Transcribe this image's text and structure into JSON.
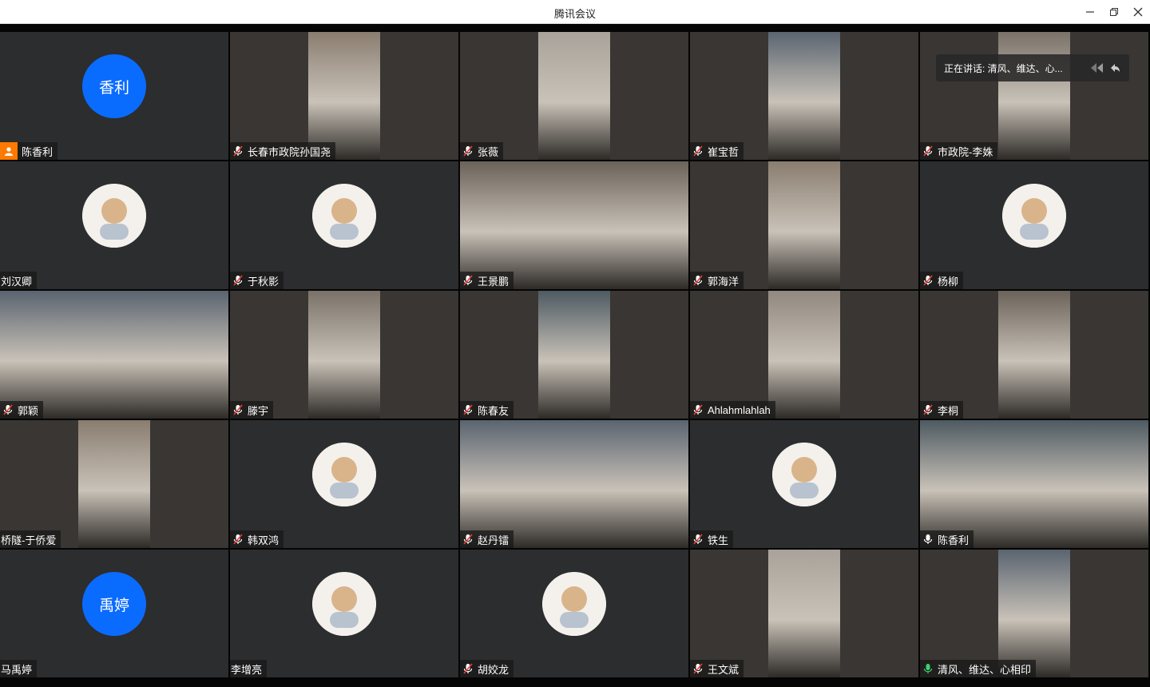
{
  "window": {
    "title": "腾讯会议"
  },
  "speaking_banner": {
    "text": "正在讲话: 清风、维达、心..."
  },
  "participants": [
    {
      "name": "陈香利",
      "kind": "text",
      "avatar_text": "香利",
      "mic": "host"
    },
    {
      "name": "长春市政院孙国尧",
      "kind": "video",
      "mic": "muted"
    },
    {
      "name": "张薇",
      "kind": "video",
      "mic": "muted"
    },
    {
      "name": "崔宝哲",
      "kind": "video",
      "mic": "muted"
    },
    {
      "name": "市政院-李姝",
      "kind": "video",
      "mic": "muted"
    },
    {
      "name": "刘汉卿",
      "kind": "img",
      "avatar_icon": "spiderman-avatar-icon",
      "mic": "none"
    },
    {
      "name": "于秋影",
      "kind": "img",
      "avatar_icon": "shiba-dog-avatar-icon",
      "mic": "muted"
    },
    {
      "name": "王景鹏",
      "kind": "video",
      "mic": "muted"
    },
    {
      "name": "郭海洋",
      "kind": "video",
      "mic": "muted"
    },
    {
      "name": "杨柳",
      "kind": "img",
      "avatar_icon": "bunny-girl-avatar-icon",
      "mic": "muted"
    },
    {
      "name": "郭颖",
      "kind": "video",
      "mic": "muted"
    },
    {
      "name": "滕宇",
      "kind": "video",
      "mic": "muted"
    },
    {
      "name": "陈春友",
      "kind": "video",
      "mic": "muted"
    },
    {
      "name": "Ahlahmlahlah",
      "kind": "video",
      "mic": "muted"
    },
    {
      "name": "李桐",
      "kind": "video",
      "mic": "muted"
    },
    {
      "name": "桥隧-于侨爱",
      "kind": "video",
      "mic": "none"
    },
    {
      "name": "韩双鸿",
      "kind": "img",
      "avatar_icon": "potato-fries-avatar-icon",
      "mic": "muted"
    },
    {
      "name": "赵丹镭",
      "kind": "video",
      "mic": "muted"
    },
    {
      "name": "铁生",
      "kind": "img",
      "avatar_icon": "walking-person-avatar-icon",
      "mic": "muted"
    },
    {
      "name": "陈香利",
      "kind": "video",
      "mic": "on"
    },
    {
      "name": "马禹婷",
      "kind": "text",
      "avatar_text": "禹婷",
      "mic": "none"
    },
    {
      "name": "李增亮",
      "kind": "img",
      "avatar_icon": "wedding-photo-avatar-icon",
      "mic": "none"
    },
    {
      "name": "胡姣龙",
      "kind": "img",
      "avatar_icon": "portrait-man-avatar-icon",
      "mic": "muted"
    },
    {
      "name": "王文斌",
      "kind": "video",
      "mic": "muted"
    },
    {
      "name": "清风、维达、心相印",
      "kind": "video",
      "mic": "speaking"
    }
  ],
  "colors": {
    "avatar_blue": "#0a6cff",
    "host_orange": "#ff7a00",
    "speaking_green": "#3bd16f",
    "muted_red": "#e8403a"
  }
}
